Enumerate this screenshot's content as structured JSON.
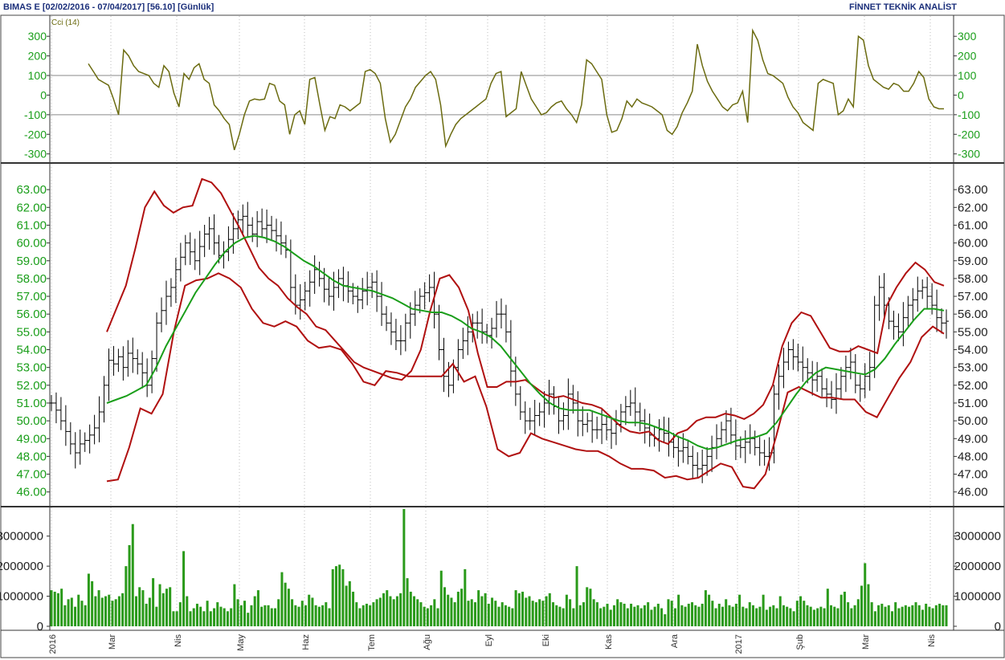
{
  "header": {
    "left": "BIMAS E  [02/02/2016 - 07/04/2017]  [56.10]  [Günlük]",
    "right": "FİNNET TEKNİK ANALİST"
  },
  "chart_data": [
    {
      "panel": "cci",
      "type": "line",
      "legend": "Cci (14)",
      "ylim": [
        -330,
        350
      ],
      "yticks": [
        300,
        200,
        100,
        0,
        -100,
        -200,
        -300
      ],
      "ytick_labels": [
        "300",
        "200",
        "100",
        "0",
        "-100",
        "-200",
        "-300"
      ],
      "reference_lines": [
        100,
        -100
      ],
      "colors": {
        "line": "#6b6b10",
        "reference": "#a0a0a0"
      },
      "series": [
        {
          "values": [
            160,
            120,
            80,
            65,
            50,
            -20,
            -100,
            230,
            200,
            150,
            120,
            110,
            100,
            60,
            40,
            150,
            120,
            10,
            -60,
            110,
            80,
            140,
            160,
            80,
            60,
            -50,
            -80,
            -120,
            -150,
            -280,
            -200,
            -100,
            -30,
            -20,
            -25,
            -20,
            60,
            50,
            -30,
            -50,
            -200,
            -100,
            -80,
            -150,
            80,
            90,
            -50,
            -180,
            -110,
            -120,
            -50,
            -60,
            -80,
            -60,
            -40,
            120,
            130,
            110,
            60,
            -120,
            -240,
            -200,
            -130,
            -60,
            -20,
            40,
            70,
            100,
            120,
            80,
            -50,
            -260,
            -200,
            -150,
            -120,
            -100,
            -80,
            -60,
            -40,
            -20,
            60,
            110,
            120,
            -110,
            -90,
            -70,
            120,
            50,
            -20,
            -60,
            -100,
            -90,
            -60,
            -40,
            -30,
            -70,
            -100,
            -140,
            -50,
            180,
            160,
            120,
            80,
            -100,
            -190,
            -180,
            -120,
            -30,
            -60,
            -20,
            -40,
            -50,
            -60,
            -80,
            -100,
            -180,
            -200,
            -160,
            -90,
            -40,
            20,
            260,
            150,
            70,
            20,
            -20,
            -60,
            -80,
            -50,
            -40,
            20,
            -140,
            330,
            280,
            180,
            110,
            100,
            80,
            60,
            -10,
            -60,
            -90,
            -140,
            -160,
            -180,
            60,
            80,
            70,
            60,
            -100,
            -80,
            -20,
            -60,
            300,
            280,
            150,
            80,
            60,
            40,
            30,
            60,
            50,
            20,
            20,
            60,
            120,
            90,
            -20,
            -60,
            -70,
            -70
          ]
        }
      ]
    },
    {
      "panel": "price",
      "type": "line",
      "ylim": [
        45.4,
        64.0
      ],
      "yticks": [
        63,
        62,
        61,
        60,
        59,
        58,
        57,
        56,
        55,
        54,
        53,
        52,
        51,
        50,
        49,
        48,
        47,
        46
      ],
      "ytick_labels": [
        "63.00",
        "62.00",
        "61.00",
        "60.00",
        "59.00",
        "58.00",
        "57.00",
        "56.00",
        "55.00",
        "54.00",
        "53.00",
        "52.00",
        "51.00",
        "50.00",
        "49.00",
        "48.00",
        "47.00",
        "46.00"
      ],
      "colors": {
        "bars": "#000000",
        "middle_band": "#1a9e1a",
        "outer_bands": "#b01010"
      },
      "series": [
        {
          "values": [
            51.0,
            50.6,
            50.0,
            49.4,
            48.7,
            48.2,
            48.7,
            48.9,
            49.2,
            49.6,
            50.5,
            52.0,
            53.4,
            53.2,
            53.6,
            53.0,
            53.8,
            53.5,
            53.2,
            52.7,
            52.0,
            53.5,
            55.5,
            56.2,
            57.0,
            57.5,
            58.5,
            59.2,
            60.0,
            59.5,
            59.0,
            59.8,
            60.5,
            60.8,
            60.0,
            59.3,
            59.5,
            60.2,
            60.8,
            61.3,
            61.5,
            61.0,
            60.5,
            61.2,
            60.8,
            61.0,
            60.7,
            60.4,
            60.0,
            59.6,
            57.5,
            56.5,
            56.8,
            57.3,
            57.8,
            58.5,
            58.0,
            57.4,
            57.0,
            57.5,
            58.0,
            57.6,
            57.3,
            57.0,
            56.8,
            57.3,
            57.5,
            57.8,
            57.0,
            56.0,
            55.5,
            55.0,
            54.5,
            54.5,
            55.5,
            56.0,
            56.5,
            57.0,
            57.2,
            57.5,
            56.0,
            54.0,
            52.5,
            52.0,
            53.0,
            54.0,
            54.5,
            55.0,
            55.5,
            55.5,
            55.0,
            54.8,
            55.2,
            56.0,
            56.0,
            55.0,
            52.8,
            51.5,
            50.5,
            50.0,
            50.0,
            50.3,
            50.5,
            51.0,
            51.5,
            50.8,
            50.0,
            50.3,
            51.5,
            51.0,
            50.0,
            49.8,
            50.0,
            49.5,
            49.5,
            49.8,
            49.5,
            49.3,
            49.8,
            50.5,
            50.8,
            51.0,
            50.5,
            50.0,
            49.6,
            49.2,
            49.0,
            49.5,
            49.3,
            48.8,
            48.5,
            48.3,
            48.5,
            48.0,
            47.5,
            47.3,
            47.5,
            48.0,
            48.5,
            49.0,
            49.5,
            50.0,
            49.2,
            48.6,
            48.5,
            48.8,
            49.0,
            48.5,
            48.2,
            48.0,
            48.2,
            51.5,
            52.5,
            53.3,
            54.0,
            53.6,
            53.3,
            53.0,
            52.7,
            52.3,
            52.5,
            51.8,
            51.5,
            51.2,
            51.8,
            52.5,
            53.0,
            53.3,
            52.0,
            51.8,
            52.5,
            53.0,
            56.5,
            57.5,
            56.5,
            55.6,
            55.3,
            55.0,
            55.8,
            56.5,
            56.8,
            57.3,
            57.5,
            57.0,
            56.5,
            55.8,
            55.5,
            55.6
          ]
        },
        {
          "name": "middle",
          "values": [
            51.0,
            51.2,
            51.4,
            51.7,
            52.0,
            53.0,
            54.2,
            55.2,
            56.2,
            57.2,
            58.0,
            58.8,
            59.5,
            60.0,
            60.3,
            60.4,
            60.3,
            60.1,
            59.8,
            59.4,
            59.0,
            58.7,
            58.3,
            57.9,
            57.6,
            57.5,
            57.4,
            57.3,
            57.1,
            56.9,
            56.6,
            56.3,
            56.2,
            56.1,
            56.1,
            55.9,
            55.6,
            55.2,
            55.0,
            54.7,
            54.2,
            53.5,
            52.8,
            52.1,
            51.5,
            51.0,
            50.7,
            50.6,
            50.6,
            50.6,
            50.4,
            50.2,
            50.0,
            49.9,
            49.9,
            49.8,
            49.6,
            49.4,
            49.1,
            48.9,
            48.6,
            48.4,
            48.5,
            48.7,
            48.9,
            49.0,
            49.1,
            49.3,
            49.9,
            50.7,
            51.5,
            52.2,
            52.7,
            53.0,
            52.9,
            52.8,
            52.7,
            52.6,
            52.9,
            53.5,
            54.3,
            55.0,
            55.7,
            56.3,
            56.3,
            56.2
          ]
        },
        {
          "name": "upper",
          "values": [
            46.6,
            46.7,
            48.5,
            50.7,
            50.4,
            51.5,
            55.0,
            57.6,
            57.9,
            58.0,
            58.3,
            58.0,
            57.5,
            56.3,
            55.5,
            55.3,
            55.6,
            55.3,
            54.5,
            54.1,
            54.2,
            54.0,
            53.2,
            52.2,
            52.0,
            52.8,
            52.7,
            52.5,
            52.5,
            52.5,
            52.5,
            53.2,
            52.2,
            52.5,
            50.8,
            48.4,
            48.0,
            48.2,
            49.3,
            49.0,
            48.8,
            48.6,
            48.4,
            48.3,
            48.3,
            48.0,
            47.6,
            47.3,
            47.3,
            47.2,
            46.8,
            46.9,
            46.7,
            46.8,
            47.2,
            47.6,
            47.4,
            46.3,
            46.2,
            47.0,
            49.2,
            51.6,
            51.9,
            51.6,
            51.3,
            51.3,
            51.2,
            51.2,
            50.5,
            50.2,
            51.3,
            52.4,
            53.3,
            54.7,
            55.3,
            54.9
          ]
        },
        {
          "name": "lower",
          "values": [
            55.0,
            56.3,
            57.6,
            59.7,
            62.0,
            62.9,
            62.1,
            61.7,
            62.0,
            62.1,
            63.6,
            63.4,
            62.8,
            61.8,
            60.8,
            59.7,
            58.6,
            58.0,
            57.6,
            56.9,
            56.4,
            56.0,
            55.3,
            55.1,
            54.5,
            53.9,
            53.3,
            53.0,
            52.8,
            52.6,
            52.4,
            52.3,
            52.8,
            54.0,
            56.2,
            58.0,
            58.2,
            57.5,
            56.2,
            53.8,
            51.9,
            51.9,
            52.2,
            52.2,
            52.3,
            51.9,
            51.5,
            51.3,
            51.4,
            51.2,
            51.0,
            50.9,
            50.7,
            50.2,
            49.7,
            49.4,
            49.3,
            49.4,
            48.9,
            48.7,
            49.3,
            49.5,
            50.0,
            50.2,
            50.2,
            50.4,
            50.3,
            50.1,
            50.4,
            50.9,
            52.0,
            54.2,
            55.5,
            56.1,
            55.9,
            55.0,
            54.1,
            53.9,
            53.9,
            54.2,
            54.0,
            53.8,
            56.5,
            57.5,
            58.3,
            58.9,
            58.5,
            57.8,
            57.6
          ]
        }
      ]
    },
    {
      "panel": "volume",
      "type": "bar",
      "ylim": [
        0,
        3900000
      ],
      "yticks": [
        3000000,
        2000000,
        1000000,
        0
      ],
      "ytick_labels": [
        "3000000",
        "2000000",
        "1000000",
        "0"
      ],
      "colors": {
        "bars": "#2a9a1a"
      },
      "series": [
        {
          "values": [
            1200000,
            1150000,
            1100000,
            1250000,
            700000,
            900000,
            950000,
            650000,
            1050000,
            850000,
            700000,
            1750000,
            1500000,
            1000000,
            1200000,
            950000,
            1000000,
            1050000,
            850000,
            900000,
            1000000,
            1100000,
            2000000,
            2700000,
            3400000,
            1000000,
            1300000,
            1200000,
            750000,
            950000,
            1600000,
            650000,
            1400000,
            1100000,
            1250000,
            1300000,
            500000,
            500000,
            800000,
            2500000,
            1000000,
            500000,
            600000,
            750000,
            650000,
            500000,
            850000,
            500000,
            600000,
            800000,
            650000,
            600000,
            500000,
            600000,
            1400000,
            900000,
            700000,
            850000,
            450000,
            700000,
            1000000,
            1200000,
            650000,
            700000,
            700000,
            600000,
            600000,
            900000,
            1800000,
            1450000,
            1250000,
            900000,
            700000,
            650000,
            850000,
            700000,
            1050000,
            950000,
            700000,
            650000,
            700000,
            800000,
            600000,
            1900000,
            2000000,
            2050000,
            1900000,
            1350000,
            1500000,
            1150000,
            800000,
            600000,
            700000,
            750000,
            700000,
            800000,
            900000,
            950000,
            1100000,
            1200000,
            1000000,
            900000,
            1000000,
            1100000,
            3900000,
            1600000,
            1150000,
            1000000,
            900000,
            800000,
            650000,
            600000,
            700000,
            900000,
            600000,
            1850000,
            1300000,
            1050000,
            950000,
            800000,
            1150000,
            1250000,
            1900000,
            850000,
            900000,
            800000,
            1200000,
            1000000,
            1100000,
            750000,
            950000,
            850000,
            650000,
            800000,
            700000,
            650000,
            600000,
            1200000,
            1100000,
            1150000,
            950000,
            1000000,
            850000,
            800000,
            900000,
            850000,
            1000000,
            1100000,
            800000,
            700000,
            650000,
            600000,
            1050000,
            900000,
            600000,
            2000000,
            700000,
            800000,
            1300000,
            1250000,
            900000,
            800000,
            600000,
            650000,
            750000,
            550000,
            700000,
            900000,
            800000,
            750000,
            600000,
            750000,
            650000,
            700000,
            600000,
            700000,
            800000,
            550000,
            650000,
            750000,
            600000,
            400000,
            900000,
            850000,
            600000,
            1050000,
            700000,
            650000,
            750000,
            800000,
            700000,
            650000,
            750000,
            1200000,
            1050000,
            850000,
            600000,
            750000,
            650000,
            900000,
            700000,
            650000,
            750000,
            1050000,
            650000,
            600000,
            800000,
            700000,
            600000,
            650000,
            1050000,
            550000,
            650000,
            700000,
            600000,
            1000000,
            700000,
            650000,
            600000,
            500000,
            850000,
            1000000,
            850000,
            700000,
            650000,
            550000,
            600000,
            650000,
            600000,
            1250000,
            700000,
            650000,
            600000,
            1050000,
            1150000,
            800000,
            600000,
            700000,
            900000,
            1350000,
            2100000,
            1400000,
            800000,
            500000,
            700000,
            750000,
            650000,
            700000,
            500000,
            800000,
            600000,
            650000,
            700000,
            650000,
            700000,
            800000,
            700000,
            550000,
            750000,
            650000,
            600000,
            700000,
            750000,
            700000,
            700000
          ]
        }
      ]
    }
  ],
  "xaxis": {
    "tick_labels": [
      "2016",
      "Mar",
      "Nis",
      "May",
      "Haz",
      "Tem",
      "Ağu",
      "Eyl",
      "Eki",
      "Kas",
      "Ara",
      "2017",
      "Şub",
      "Mar",
      "Nis"
    ]
  }
}
